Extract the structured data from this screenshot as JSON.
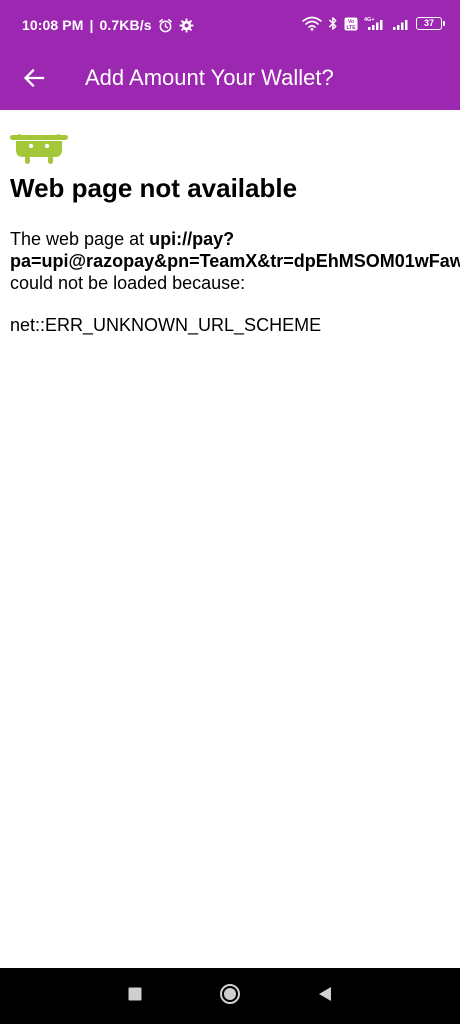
{
  "status_bar": {
    "time": "10:08 PM",
    "separator": "|",
    "network_speed": "0.7KB/s",
    "battery_level": "37",
    "icons": [
      "alarm-icon",
      "settings-gear-icon",
      "wifi-icon",
      "bluetooth-icon",
      "volte-icon",
      "signal-4g-icon",
      "signal-icon",
      "battery-icon"
    ]
  },
  "app_bar": {
    "title": "Add Amount Your Wallet?",
    "back_icon": "back-arrow-icon"
  },
  "error_page": {
    "title": "Web page not available",
    "body_prefix": "The web page at ",
    "url_line1": "upi://pay?",
    "url_line2": "pa=upi@razopay&pn=TeamX&tr=dpEhMSOM01wFaw",
    "body_suffix": "could not be loaded because:",
    "error_code": "net::ERR_UNKNOWN_URL_SCHEME"
  },
  "nav_bar": {
    "buttons": [
      "recents-square-icon",
      "home-circle-icon",
      "back-triangle-icon"
    ]
  },
  "colors": {
    "app_bar": "#9c27b0",
    "android_green": "#a4c639",
    "nav_bar": "#000000"
  }
}
